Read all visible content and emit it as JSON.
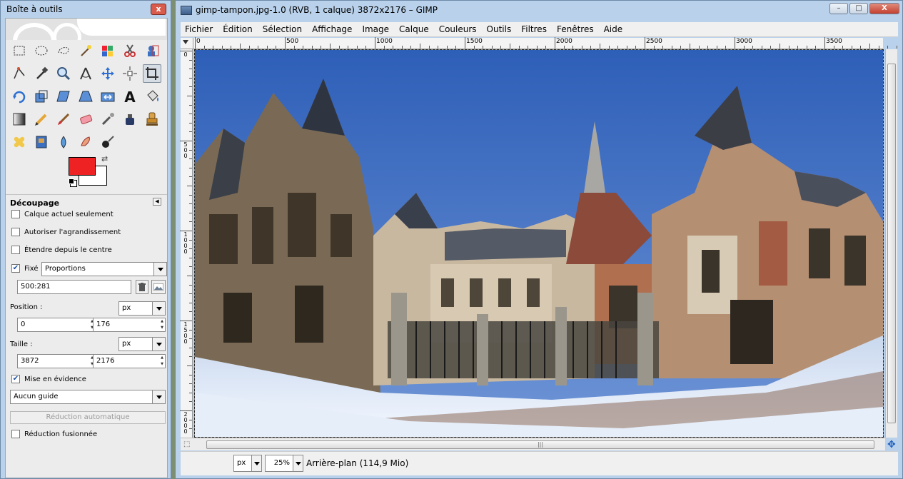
{
  "toolbox": {
    "title": "Boîte à outils",
    "close_label": "x",
    "tools": [
      "rect-select-icon",
      "ellipse-select-icon",
      "free-select-icon",
      "fuzzy-select-icon",
      "color-select-icon",
      "scissors-icon",
      "foreground-select-icon",
      "paths-icon",
      "color-picker-icon",
      "zoom-icon",
      "measure-icon",
      "move-icon",
      "align-icon",
      "crop-icon",
      "rotate-icon",
      "scale-icon",
      "shear-icon",
      "perspective-icon",
      "flip-icon",
      "text-icon",
      "bucket-fill-icon",
      "blend-icon",
      "pencil-icon",
      "paintbrush-icon",
      "eraser-icon",
      "airbrush-icon",
      "ink-icon",
      "clone-icon",
      "heal-icon",
      "perspective-clone-icon",
      "blur-icon",
      "smudge-icon",
      "dodge-burn-icon"
    ],
    "fg_color": "#ee2222",
    "bg_color": "#ffffff",
    "options": {
      "title": "Découpage",
      "current_layer_only": "Calque actuel seulement",
      "allow_growing": "Autoriser l'agrandissement",
      "expand_from_center": "Étendre depuis le centre",
      "fixed_label": "Fixé :",
      "fixed_value": "Proportions",
      "ratio_value": "500:281",
      "position_label": "Position :",
      "position_unit": "px",
      "position_x": "0",
      "position_y": "176",
      "size_label": "Taille :",
      "size_unit": "px",
      "size_w": "3872",
      "size_h": "2176",
      "highlight": "Mise en évidence",
      "guides_value": "Aucun guide",
      "auto_shrink": "Réduction automatique",
      "shrink_merged": "Réduction fusionnée",
      "checked_fixed": true,
      "checked_highlight": true
    }
  },
  "window": {
    "title": "gimp-tampon.jpg-1.0 (RVB, 1 calque) 3872x2176 – GIMP",
    "minimize": "–",
    "maximize": "□",
    "close": "X",
    "menu": [
      "Fichier",
      "Édition",
      "Sélection",
      "Affichage",
      "Image",
      "Calque",
      "Couleurs",
      "Outils",
      "Filtres",
      "Fenêtres",
      "Aide"
    ],
    "hruler_labels": [
      "0",
      "500",
      "1000",
      "1500",
      "2000",
      "2500",
      "3000",
      "3500"
    ],
    "vruler_labels": [
      [
        "0"
      ],
      [
        "5",
        "0",
        "0"
      ],
      [
        "1",
        "0",
        "0",
        "0"
      ],
      [
        "1",
        "5",
        "0",
        "0"
      ],
      [
        "2",
        "0",
        "0",
        "0"
      ]
    ],
    "status": {
      "unit": "px",
      "zoom": "25%",
      "layer_info": "Arrière-plan (114,9 Mio)"
    },
    "hscroll_grip": "|||"
  },
  "colors": {
    "accent_blue": "#1f5fbf",
    "sky": "#3b6fc2",
    "snow": "#eef4fb"
  }
}
